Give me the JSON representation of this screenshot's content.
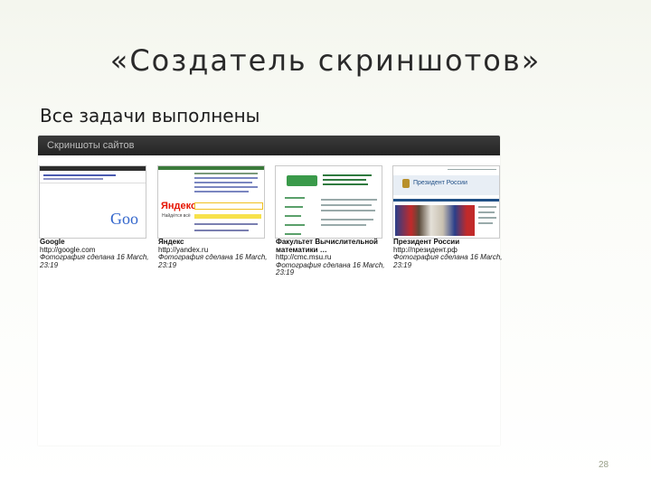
{
  "slide": {
    "title": "«Создатель скриншотов»",
    "subtitle": "Все задачи выполнены",
    "page_number": "28"
  },
  "app": {
    "header_title": "Скриншоты сайтов",
    "thumbnails": [
      {
        "title": "Google",
        "url": "http://google.com",
        "date": "Фотография сделана 16 March, 23:19",
        "logo_text": "Goo"
      },
      {
        "title": "Яндекс",
        "url": "http://yandex.ru",
        "date": "Фотография сделана 16 March, 23:19",
        "logo_text": "Яндекс",
        "logo_sub": "Найдётся всё"
      },
      {
        "title": "Факультет Вычислительной математики …",
        "url": "http://cmc.msu.ru",
        "date": "Фотография сделана 16 March, 23:19"
      },
      {
        "title": "Президент России",
        "url": "http://президент.рф",
        "date": "Фотография сделана 16 March, 23:19",
        "banner_text": "Президент России"
      }
    ]
  },
  "colors": {
    "header_bg": "#2e2e2e",
    "google_blue": "#3366cc",
    "yandex_red": "#e61400",
    "cmc_green": "#3a9a4a",
    "kremlin_blue": "#1f4f86"
  }
}
